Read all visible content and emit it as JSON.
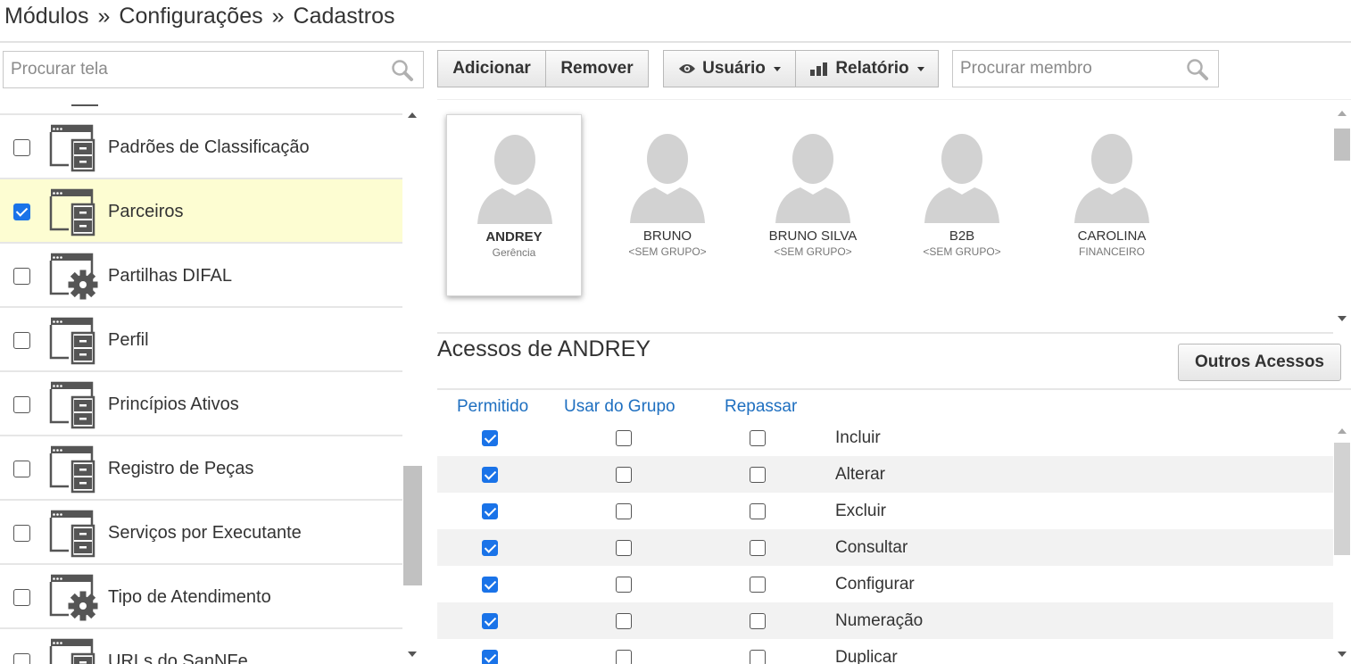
{
  "breadcrumb": {
    "items": [
      "Módulos",
      "Configurações",
      "Cadastros"
    ],
    "separator": "»"
  },
  "screen_search": {
    "placeholder": "Procurar tela",
    "value": ""
  },
  "screens": [
    {
      "label": "Padrões de Classificação",
      "checked": false,
      "icon": "window-cabinet-icon"
    },
    {
      "label": "Parceiros",
      "checked": true,
      "icon": "window-cabinet-icon",
      "selected": true
    },
    {
      "label": "Partilhas DIFAL",
      "checked": false,
      "icon": "window-gear-icon"
    },
    {
      "label": "Perfil",
      "checked": false,
      "icon": "window-cabinet-icon"
    },
    {
      "label": "Princípios Ativos",
      "checked": false,
      "icon": "window-cabinet-icon"
    },
    {
      "label": "Registro de Peças",
      "checked": false,
      "icon": "window-cabinet-icon"
    },
    {
      "label": "Serviços por Executante",
      "checked": false,
      "icon": "window-cabinet-icon"
    },
    {
      "label": "Tipo de Atendimento",
      "checked": false,
      "icon": "window-gear-icon"
    },
    {
      "label": "URLs do SanNFe",
      "checked": false,
      "icon": "window-cabinet-icon"
    }
  ],
  "toolbar": {
    "add_label": "Adicionar",
    "remove_label": "Remover",
    "user_label": "Usuário",
    "report_label": "Relatório"
  },
  "member_search": {
    "placeholder": "Procurar membro",
    "value": ""
  },
  "members": [
    {
      "name": "ANDREY",
      "group": "Gerência",
      "selected": true
    },
    {
      "name": "BRUNO",
      "group": "<SEM GRUPO>"
    },
    {
      "name": "BRUNO SILVA",
      "group": "<SEM GRUPO>"
    },
    {
      "name": "B2B",
      "group": "<SEM GRUPO>"
    },
    {
      "name": "CAROLINA",
      "group": "FINANCEIRO"
    }
  ],
  "access": {
    "title": "Acessos de ANDREY",
    "other_button": "Outros Acessos",
    "columns": [
      "Permitido",
      "Usar do Grupo",
      "Repassar"
    ],
    "rows": [
      {
        "label": "Incluir",
        "permitido": true,
        "usar_grupo": false,
        "repassar": false
      },
      {
        "label": "Alterar",
        "permitido": true,
        "usar_grupo": false,
        "repassar": false
      },
      {
        "label": "Excluir",
        "permitido": true,
        "usar_grupo": false,
        "repassar": false
      },
      {
        "label": "Consultar",
        "permitido": true,
        "usar_grupo": false,
        "repassar": false
      },
      {
        "label": "Configurar",
        "permitido": true,
        "usar_grupo": false,
        "repassar": false
      },
      {
        "label": "Numeração",
        "permitido": true,
        "usar_grupo": false,
        "repassar": false
      },
      {
        "label": "Duplicar",
        "permitido": true,
        "usar_grupo": false,
        "repassar": false
      }
    ]
  },
  "colors": {
    "accent": "#1a73e8",
    "selected_row": "#fdfdd2",
    "column_header": "#1e6fc0"
  }
}
